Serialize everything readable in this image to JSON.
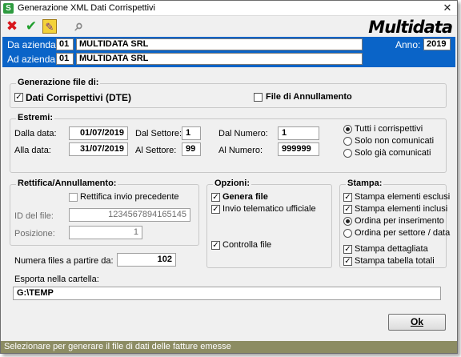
{
  "window": {
    "title": "Generazione XML Dati Corrispettivi",
    "close_glyph": "✕"
  },
  "toolbar": {
    "cancel_glyph": "✖",
    "confirm_glyph": "✔",
    "edit_glyph": "✎",
    "binoculars_glyph": "⌕"
  },
  "brand": {
    "logo": "Multidata"
  },
  "company": {
    "from_label": "Da azienda:",
    "from_code": "01",
    "from_name": "MULTIDATA SRL",
    "to_label": "Ad azienda:",
    "to_code": "01",
    "to_name": "MULTIDATA SRL",
    "year_label": "Anno:",
    "year_value": "2019"
  },
  "generazione": {
    "title": "Generazione file di:",
    "dati_label": "Dati Corrispettivi (DTE)",
    "dati_check": "✓",
    "annullamento_label": "File di Annullamento"
  },
  "estremi": {
    "title": "Estremi:",
    "dalla_data_label": "Dalla data:",
    "dalla_data_value": "01/07/2019",
    "alla_data_label": "Alla data:",
    "alla_data_value": "31/07/2019",
    "dal_settore_label": "Dal Settore:",
    "dal_settore_value": "1",
    "al_settore_label": "Al Settore:",
    "al_settore_value": "99",
    "dal_numero_label": "Dal Numero:",
    "dal_numero_value": "1",
    "al_numero_label": "Al Numero:",
    "al_numero_value": "999999",
    "radio_tutti": "Tutti i corrispettivi",
    "radio_non_comunicati": "Solo non comunicati",
    "radio_gia_comunicati": "Solo già comunicati"
  },
  "rettifica": {
    "title": "Rettifica/Annullamento:",
    "checkbox_label": "Rettifica invio precedente",
    "id_file_label": "ID del file:",
    "id_file_value": "1234567894165145",
    "posizione_label": "Posizione:",
    "posizione_value": "1"
  },
  "opzioni": {
    "title": "Opzioni:",
    "genera_file": "Genera file",
    "genera_check": "✓",
    "invio_telematico": "Invio telematico ufficiale",
    "invio_check": "✓",
    "controlla_file": "Controlla file",
    "controlla_check": "✓"
  },
  "stampa": {
    "title": "Stampa:",
    "elementi_esclusi": "Stampa elementi esclusi",
    "esclusi_check": "✓",
    "elementi_inclusi": "Stampa elementi inclusi",
    "inclusi_check": "✓",
    "ordina_inserimento": "Ordina per inserimento",
    "ordina_settore": "Ordina per settore / data",
    "dettagliata": "Stampa dettagliata",
    "dettagliata_check": "✓",
    "tabella_totali": "Stampa tabella totali",
    "totali_check": "✓"
  },
  "numera": {
    "label": "Numera files a partire da:",
    "value": "102"
  },
  "esporta": {
    "label": "Esporta nella cartella:",
    "value": "G:\\TEMP"
  },
  "ok_label": "Ok",
  "status": "Selezionare per generare il file di dati delle fatture emesse"
}
